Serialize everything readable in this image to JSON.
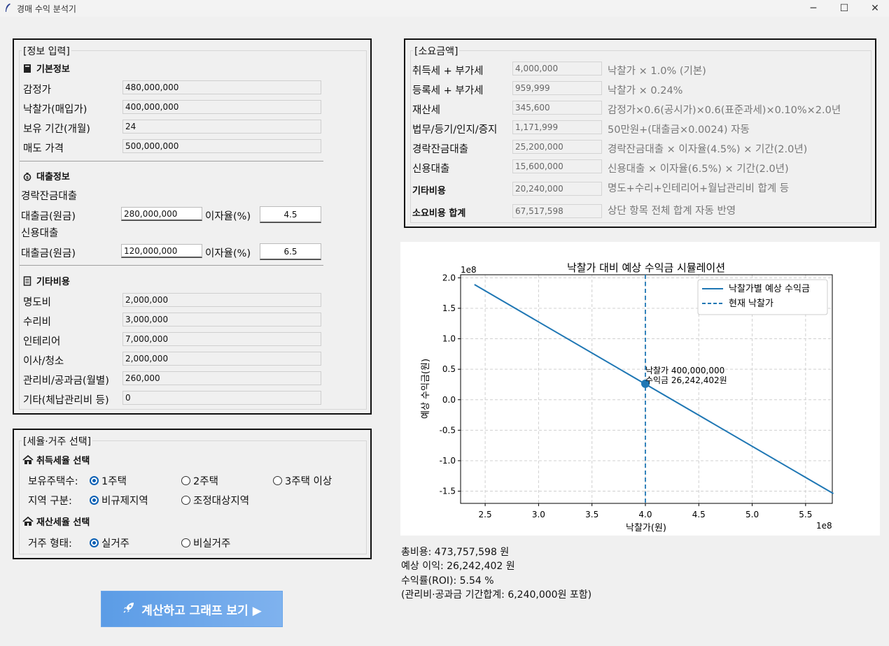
{
  "window": {
    "title": "경매 수익 분석기",
    "minimize_glyph": "─",
    "maximize_glyph": "☐",
    "close_glyph": "✕"
  },
  "info": {
    "legend": "[정보 입력]",
    "basic_header": "기본정보",
    "basic": [
      {
        "label": "감정가",
        "value": "480,000,000"
      },
      {
        "label": "낙찰가(매입가)",
        "value": "400,000,000"
      },
      {
        "label": "보유 기간(개월)",
        "value": "24"
      },
      {
        "label": "매도 가격",
        "value": "500,000,000"
      }
    ],
    "loan_header": "대출정보",
    "loan1_title": "경락잔금대출",
    "loan1_amount_label": "대출금(원금)",
    "loan1_amount": "280,000,000",
    "loan1_rate_label": "이자율(%)",
    "loan1_rate": "4.5",
    "loan2_title": "신용대출",
    "loan2_amount_label": "대출금(원금)",
    "loan2_amount": "120,000,000",
    "loan2_rate_label": "이자율(%)",
    "loan2_rate": "6.5",
    "other_header": "기타비용",
    "other": [
      {
        "label": "명도비",
        "value": "2,000,000"
      },
      {
        "label": "수리비",
        "value": "3,000,000"
      },
      {
        "label": "인테리어",
        "value": "7,000,000"
      },
      {
        "label": "이사/청소",
        "value": "2,000,000"
      },
      {
        "label": "관리비/공과금(월별)",
        "value": "260,000"
      },
      {
        "label": "기타(체납관리비 등)",
        "value": "0"
      }
    ]
  },
  "tax": {
    "legend": "[세율·거주 선택]",
    "acq_header": "취득세율 선택",
    "houses_label": "보유주택수:",
    "houses_options": [
      "1주택",
      "2주택",
      "3주택 이상"
    ],
    "region_label": "지역 구분:",
    "region_options": [
      "비규제지역",
      "조정대상지역"
    ],
    "prop_header": "재산세율 선택",
    "residence_label": "거주 형태:",
    "residence_options": [
      "실거주",
      "비실거주"
    ]
  },
  "costs": {
    "legend": "[소요금액]",
    "rows": [
      {
        "label": "취득세 + 부가세",
        "value": "4,000,000",
        "desc": "낙찰가 × 1.0% (기본)"
      },
      {
        "label": "등록세 + 부가세",
        "value": "959,999",
        "desc": "낙찰가 × 0.24%"
      },
      {
        "label": "재산세",
        "value": "345,600",
        "desc": "감정가×0.6(공시가)×0.6(표준과세)×0.10%×2.0년"
      },
      {
        "label": "법무/등기/인지/증지",
        "value": "1,171,999",
        "desc": "50만원+(대출금×0.0024) 자동"
      },
      {
        "label": "경락잔금대출",
        "value": "25,200,000",
        "desc": "경락잔금대출 × 이자율(4.5%) × 기간(2.0년)"
      },
      {
        "label": "신용대출",
        "value": "15,600,000",
        "desc": "신용대출 × 이자율(6.5%) × 기간(2.0년)"
      },
      {
        "label": "기타비용",
        "value": "20,240,000",
        "desc": "명도+수리+인테리어+월납관리비 합계 등"
      },
      {
        "label": "소요비용 합계",
        "value": "67,517,598",
        "desc": "상단 항목 전체 합계 자동 반영"
      }
    ]
  },
  "chart_data": {
    "type": "line",
    "title": "낙찰가 대비 예상 수익금 시뮬레이션",
    "xlabel": "낙찰가(원)",
    "ylabel": "예상 수익금(원)",
    "x_offset_label": "1e8",
    "y_offset_label": "1e8",
    "xlim": [
      2.27,
      5.75
    ],
    "ylim": [
      -1.7,
      2.05
    ],
    "xticks": [
      2.5,
      3.0,
      3.5,
      4.0,
      4.5,
      5.0,
      5.5
    ],
    "xtick_labels": [
      "2.5",
      "3.0",
      "3.5",
      "4.0",
      "4.5",
      "5.0",
      "5.5"
    ],
    "yticks": [
      2.0,
      1.5,
      1.0,
      0.5,
      0.0,
      -0.5,
      -1.0,
      -1.5
    ],
    "ytick_labels": [
      "2.0",
      "1.5",
      "1.0",
      "0.5",
      "0.0",
      "-0.5",
      "-1.0",
      "-1.5"
    ],
    "grid": true,
    "legend_position": "top-right",
    "series": [
      {
        "name": "낙찰가별 예상 수익금",
        "color": "#1f77b4",
        "style": "solid",
        "x": [
          2.4,
          5.76
        ],
        "y": [
          1.89,
          -1.54
        ]
      }
    ],
    "vline": {
      "name": "현재 낙찰가",
      "x": 4.0,
      "color": "#1f77b4",
      "style": "dashed"
    },
    "point": {
      "x": 4.0,
      "y": 0.2624
    },
    "annotation_line1": "낙찰가 400,000,000",
    "annotation_line2": "수익금 26,242,402원"
  },
  "summary": {
    "total_cost": "총비용: 473,757,598 원",
    "profit": "예상 이익: 26,242,402 원",
    "roi": "수익률(ROI): 5.54 %",
    "mgmt": "(관리비·공과금 기간합계: 6,240,000원 포함)"
  },
  "button": {
    "label": "계산하고 그래프 보기 ▶"
  }
}
